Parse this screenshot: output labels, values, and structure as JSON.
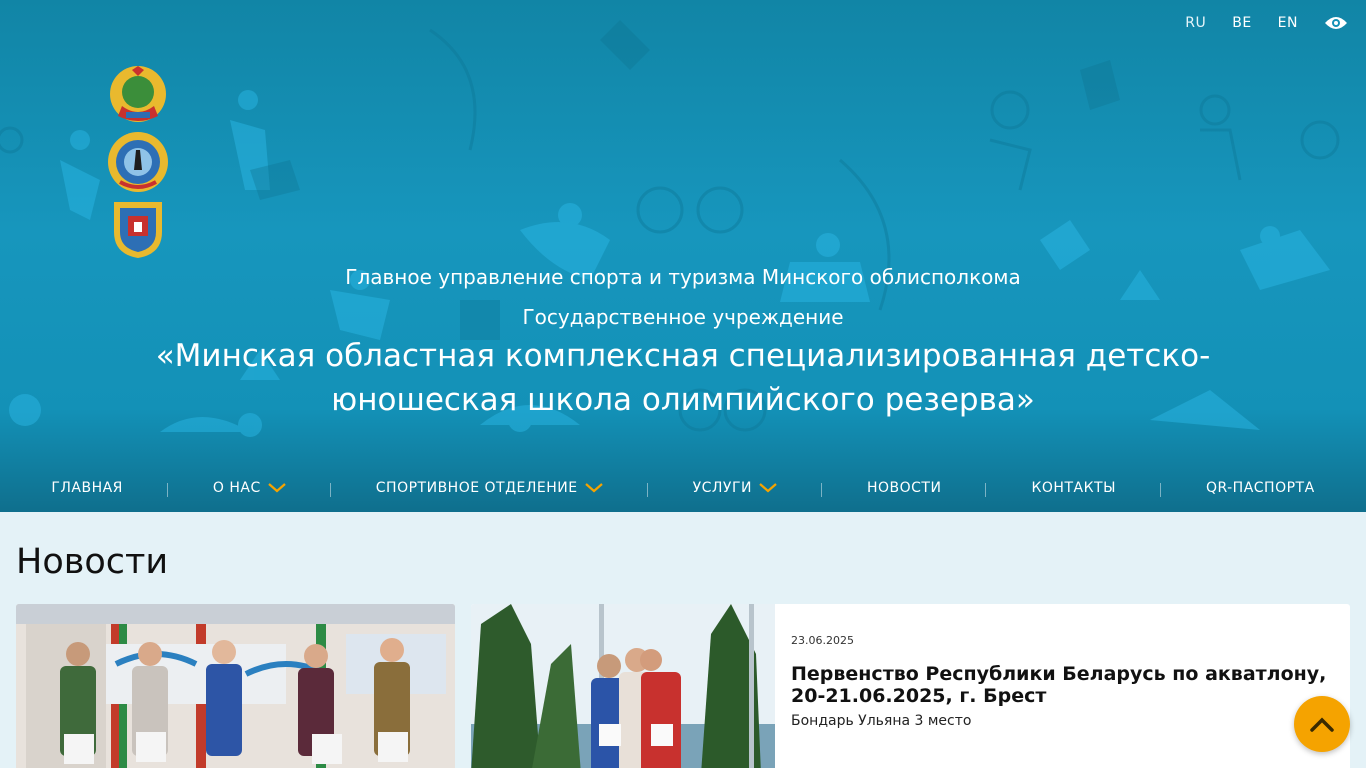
{
  "header": {
    "languages": [
      {
        "code": "RU",
        "active": true
      },
      {
        "code": "BE",
        "active": false
      },
      {
        "code": "EN",
        "active": false
      }
    ],
    "accessibility_icon": "eye-icon",
    "emblems": [
      "belarus-emblem-icon",
      "minsk-region-emblem-icon",
      "minsk-oblast-coat-icon"
    ],
    "line1": "Главное управление спорта и туризма Минского облисполкома",
    "line2": "Государственное учреждение",
    "line3": "«Минская областная комплексная специализированная детско-юношеская школа олимпийского резерва»"
  },
  "nav": {
    "items": [
      {
        "label": "ГЛАВНАЯ",
        "dropdown": false
      },
      {
        "label": "О НАС",
        "dropdown": true
      },
      {
        "label": "СПОРТИВНОЕ ОТДЕЛЕНИЕ",
        "dropdown": true
      },
      {
        "label": "УСЛУГИ",
        "dropdown": true
      },
      {
        "label": "НОВОСТИ",
        "dropdown": false
      },
      {
        "label": "КОНТАКТЫ",
        "dropdown": false
      },
      {
        "label": "QR-ПАСПОРТА",
        "dropdown": false
      }
    ],
    "chevron_color": "#f5a300"
  },
  "news": {
    "heading": "Новости",
    "featured": {
      "date": "23.06.2025",
      "title": "Первенство Республики Беларусь по акватлону, 20-21.06.2025, г. Брест",
      "description": "Бондарь Ульяна 3 место"
    }
  },
  "colors": {
    "header_bg": "#1591b7",
    "accent": "#f5a300",
    "content_bg": "#e4f2f7"
  },
  "scroll_top_icon": "chevron-up-icon"
}
